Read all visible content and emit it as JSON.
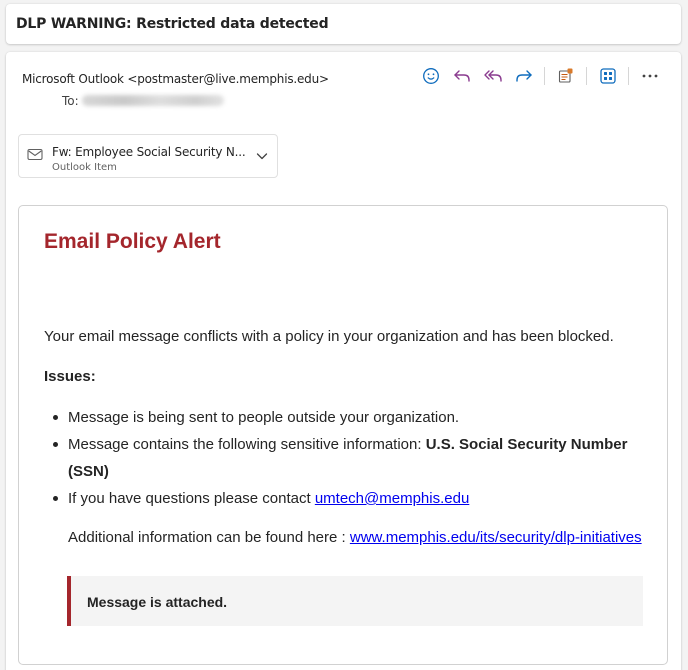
{
  "subject": "DLP WARNING: Restricted data detected",
  "header": {
    "from": "Microsoft Outlook <postmaster@live.memphis.edu>",
    "to_label": "To:"
  },
  "toolbar": {
    "icons": [
      "emoji-icon",
      "reply-icon",
      "reply-all-icon",
      "forward-icon",
      "sticky-note-icon",
      "apps-icon",
      "more-icon"
    ]
  },
  "attachment": {
    "name": "Fw: Employee Social Security N...",
    "type": "Outlook Item"
  },
  "body": {
    "title": "Email Policy Alert",
    "intro": "Your email message conflicts with a policy in your organization and has been blocked.",
    "issues_heading": "Issues:",
    "issues": {
      "item1": "Message is being sent to people outside your organization.",
      "item2_prefix": "Message contains the following sensitive information: ",
      "item2_bold": "U.S. Social Security Number (SSN)",
      "item3_prefix": "If you have questions please contact ",
      "item3_link": "umtech@memphis.edu"
    },
    "additional_prefix": "Additional information can be found here : ",
    "additional_link": "www.memphis.edu/its/security/dlp-initiatives",
    "attached_note": "Message is attached."
  },
  "colors": {
    "alert_red": "#a4262c",
    "link_blue": "#0000ee",
    "icon_blue": "#0f6cbd",
    "icon_purple": "#8a3b8f"
  }
}
